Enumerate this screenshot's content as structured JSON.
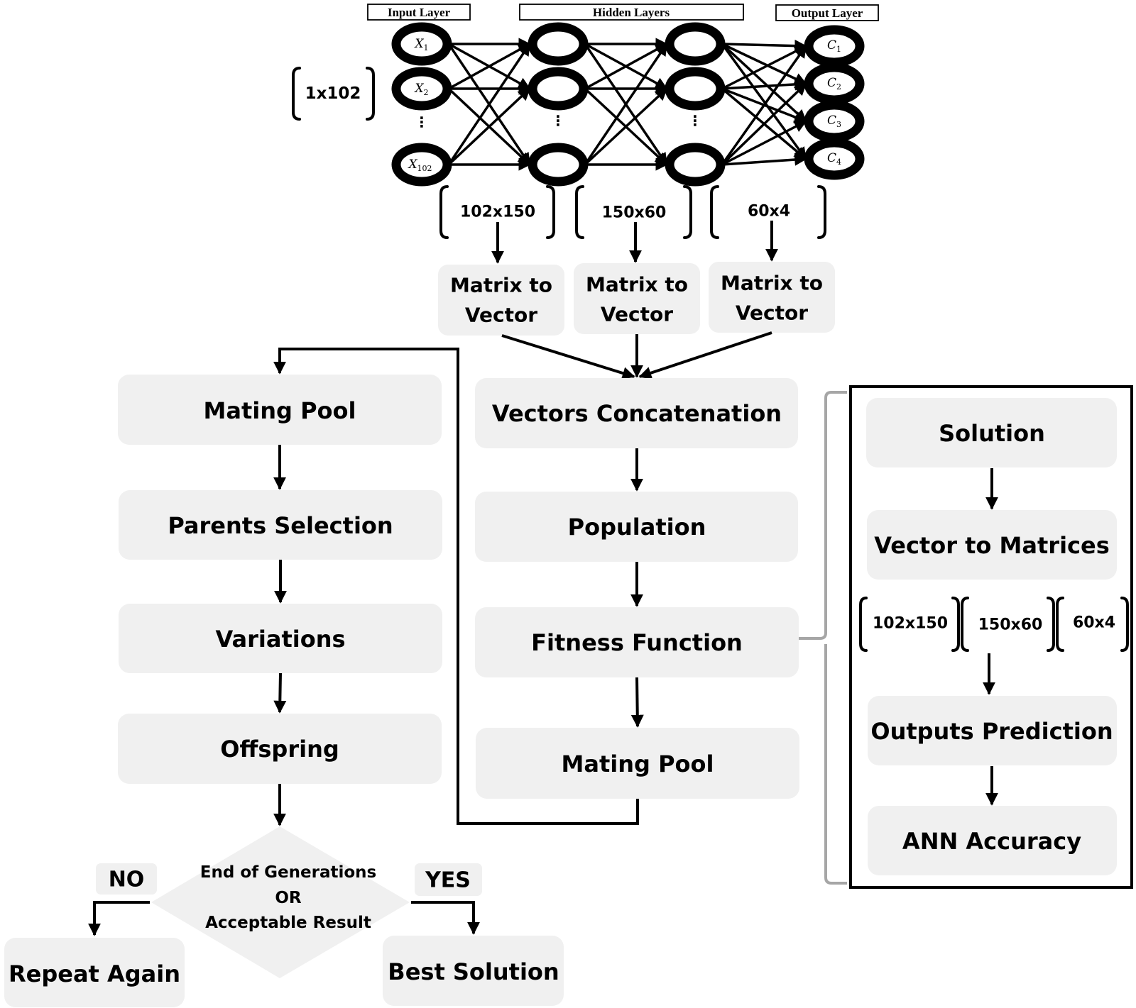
{
  "network": {
    "headers": {
      "input": "Input Layer",
      "hidden": "Hidden Layers",
      "output": "Output Layer"
    },
    "input_nodes": [
      {
        "base": "X",
        "sub": "1"
      },
      {
        "base": "X",
        "sub": "2"
      },
      {
        "base": "X",
        "sub": "102"
      }
    ],
    "output_nodes": [
      {
        "base": "C",
        "sub": "1"
      },
      {
        "base": "C",
        "sub": "2"
      },
      {
        "base": "C",
        "sub": "3"
      },
      {
        "base": "C",
        "sub": "4"
      }
    ],
    "ellipsis": "⋮",
    "input_dim": "1x102",
    "weight_dims": [
      "102x150",
      "150x60",
      "60x4"
    ]
  },
  "matrix_to_vector": {
    "line1": "Matrix to",
    "line2": "Vector"
  },
  "center_flow": [
    "Vectors Concatenation",
    "Population",
    "Fitness Function",
    "Mating Pool"
  ],
  "left_flow": [
    "Mating Pool",
    "Parents Selection",
    "Variations",
    "Offspring"
  ],
  "decision": {
    "line1": "End of Generations",
    "line2": "OR",
    "line3": "Acceptable Result",
    "no_label": "NO",
    "yes_label": "YES",
    "no_result": "Repeat Again",
    "yes_result": "Best Solution"
  },
  "fitness_detail": {
    "steps_top": [
      "Solution",
      "Vector to Matrices"
    ],
    "dims": [
      "102x150",
      "150x60",
      "60x4"
    ],
    "steps_bottom": [
      "Outputs Prediction",
      "ANN Accuracy"
    ]
  }
}
